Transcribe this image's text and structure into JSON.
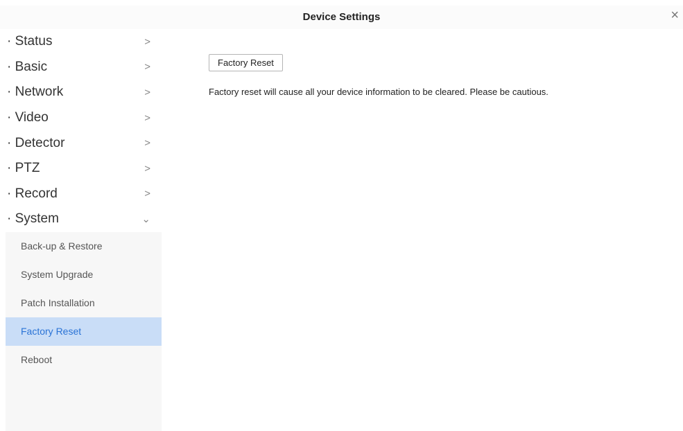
{
  "window": {
    "title": "Device Settings",
    "close_glyph": "×"
  },
  "sidebar": {
    "items": [
      {
        "label": "· Status",
        "chevron": ">"
      },
      {
        "label": "· Basic",
        "chevron": ">"
      },
      {
        "label": "· Network",
        "chevron": ">"
      },
      {
        "label": "· Video",
        "chevron": ">"
      },
      {
        "label": "· Detector",
        "chevron": ">"
      },
      {
        "label": "· PTZ",
        "chevron": ">"
      },
      {
        "label": "· Record",
        "chevron": ">"
      },
      {
        "label": "· System",
        "chevron": "⌄"
      }
    ],
    "system_subitems": [
      {
        "label": "Back-up & Restore"
      },
      {
        "label": "System Upgrade"
      },
      {
        "label": "Patch Installation"
      },
      {
        "label": "Factory Reset",
        "active": true
      },
      {
        "label": "Reboot"
      }
    ]
  },
  "main": {
    "button_label": "Factory Reset",
    "description": "Factory reset will cause all your device information to be cleared. Please be cautious."
  },
  "colors": {
    "active_bg": "#c9ddf7",
    "active_text": "#2a73d6",
    "sidebar_bg": "#f7f7f7"
  }
}
